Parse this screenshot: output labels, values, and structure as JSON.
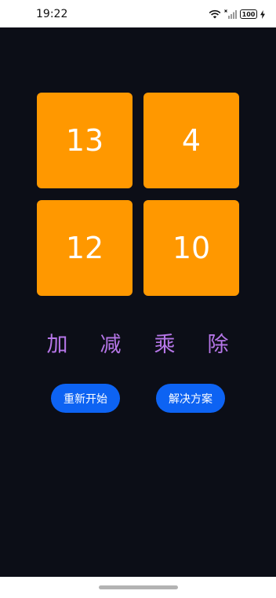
{
  "status_bar": {
    "time": "19:22",
    "battery": "100",
    "icons": [
      "wifi-icon",
      "signal-icon",
      "battery-icon",
      "charging-icon"
    ]
  },
  "cards": [
    {
      "value": "13"
    },
    {
      "value": "4"
    },
    {
      "value": "12"
    },
    {
      "value": "10"
    }
  ],
  "operators": [
    {
      "label": "加"
    },
    {
      "label": "减"
    },
    {
      "label": "乘"
    },
    {
      "label": "除"
    }
  ],
  "buttons": {
    "restart_label": "重新开始",
    "solve_label": "解决方案"
  },
  "colors": {
    "background": "#0c0e17",
    "card": "#ff9800",
    "operator": "#b676e8",
    "button": "#0d63f3"
  }
}
